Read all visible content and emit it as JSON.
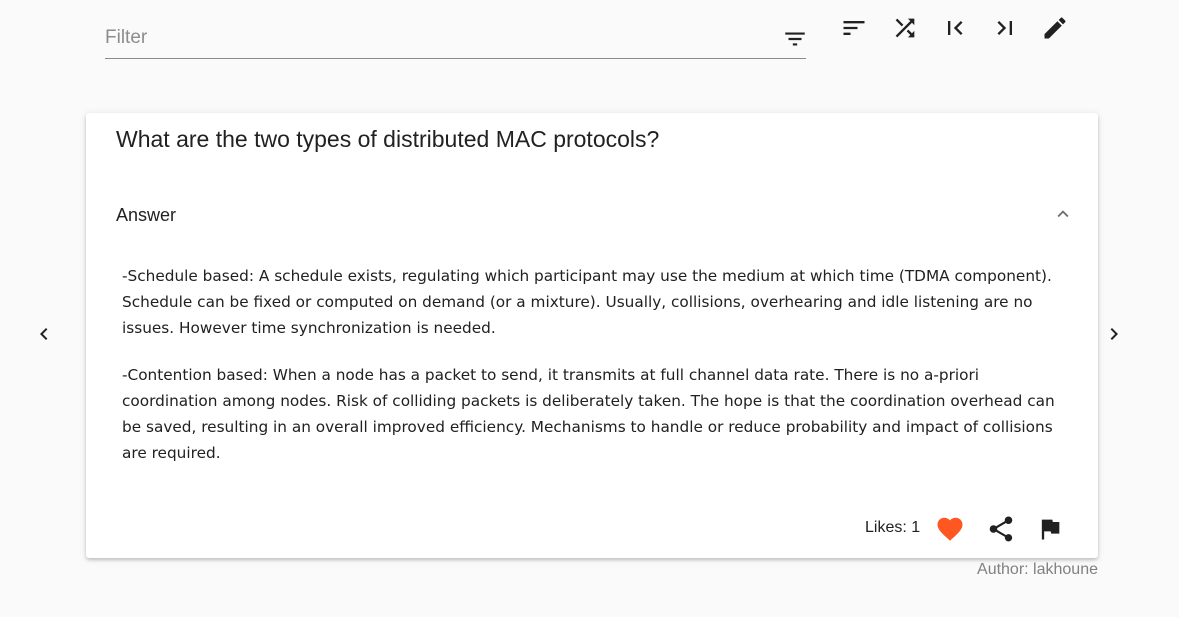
{
  "toolbar": {
    "filter_placeholder": "Filter",
    "filter_icon": "filter-list-icon",
    "buttons": [
      {
        "name": "sort-button",
        "icon": "sort-icon"
      },
      {
        "name": "shuffle-button",
        "icon": "shuffle-icon"
      },
      {
        "name": "first-card-button",
        "icon": "first-page-icon"
      },
      {
        "name": "last-card-button",
        "icon": "last-page-icon"
      },
      {
        "name": "edit-button",
        "icon": "pencil-icon"
      }
    ]
  },
  "card": {
    "question": "What are the two types of distributed MAC protocols?",
    "answer_label": "Answer",
    "answer_expanded": true,
    "answer_paragraphs": [
      "-Schedule based: A schedule exists, regulating which participant may use the medium at which time (TDMA component). Schedule can be fixed or computed on demand (or a mixture). Usually, collisions, overhearing and idle listening are no issues. However time synchronization is needed.",
      "-Contention based: When a node has a packet to send, it transmits at full channel data rate. There is no a-priori coordination among nodes. Risk of colliding packets is deliberately taken. The hope is that the coordination overhead can be saved, resulting in an overall improved efficiency. Mechanisms to handle or reduce probability and impact of collisions are required."
    ],
    "likes_text": "Likes: 1",
    "liked": true,
    "author_text": "Author: lakhoune"
  },
  "navigation": {
    "prev_icon": "chevron-left-icon",
    "next_icon": "chevron-right-icon"
  },
  "colors": {
    "background": "#fafafa",
    "card": "#ffffff",
    "text": "#212121",
    "muted": "#808080",
    "heart": "#ff5722",
    "icon": "#212121"
  }
}
